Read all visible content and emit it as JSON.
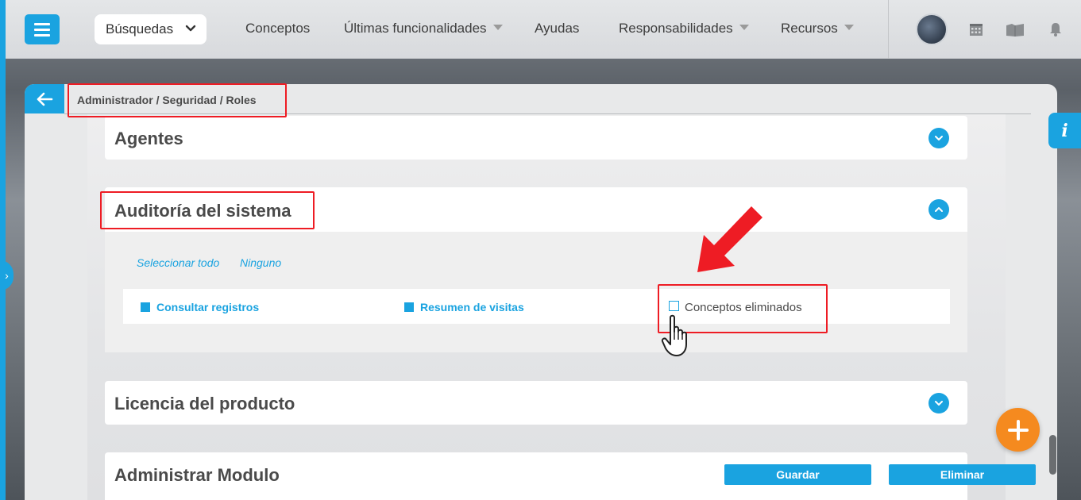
{
  "topbar": {
    "search_label": "Búsquedas",
    "nav": [
      {
        "label": "Conceptos",
        "has_caret": false
      },
      {
        "label": "Últimas funcionalidades",
        "has_caret": true
      },
      {
        "label": "Ayudas",
        "has_caret": false
      },
      {
        "label": "Responsabilidades",
        "has_caret": true
      },
      {
        "label": "Recursos",
        "has_caret": true
      }
    ],
    "icons": [
      "calendar-icon",
      "folder-icon",
      "bell-icon"
    ]
  },
  "breadcrumb": "Administrador / Seguridad / Roles",
  "sections": {
    "agentes": "Agentes",
    "auditoria": "Auditoría del sistema",
    "licencia": "Licencia del producto",
    "administrar": "Administrar Modulo"
  },
  "audit": {
    "select_all": "Seleccionar todo",
    "none": "Ninguno",
    "permissions": [
      {
        "label": "Consultar registros",
        "checked": true
      },
      {
        "label": "Resumen de visitas",
        "checked": true
      },
      {
        "label": "Conceptos eliminados",
        "checked": false
      }
    ]
  },
  "actions": {
    "save": "Guardar",
    "delete": "Eliminar"
  },
  "info_label": "i",
  "colors": {
    "accent": "#1aa3e0",
    "highlight": "#ee1c24",
    "fab": "#f58a1f"
  }
}
